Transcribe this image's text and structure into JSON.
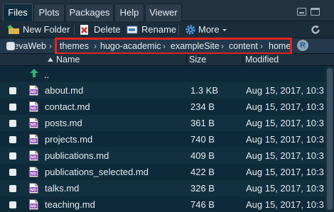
{
  "tabs": [
    {
      "label": "Files",
      "active": true
    },
    {
      "label": "Plots",
      "active": false
    },
    {
      "label": "Packages",
      "active": false
    },
    {
      "label": "Help",
      "active": false
    },
    {
      "label": "Viewer",
      "active": false
    }
  ],
  "toolbar": {
    "new_folder": "New Folder",
    "delete": "Delete",
    "rename": "Rename",
    "more": "More"
  },
  "breadcrumb": {
    "first": "evaWeb",
    "items": [
      "themes",
      "hugo-academic",
      "exampleSite",
      "content",
      "home"
    ]
  },
  "columns": {
    "name": "Name",
    "size": "Size",
    "modified": "Modified"
  },
  "parent_dir": "..",
  "files": [
    {
      "name": "about.md",
      "size": "1.3 KB",
      "modified": "Aug 15, 2017, 10:3"
    },
    {
      "name": "contact.md",
      "size": "234 B",
      "modified": "Aug 15, 2017, 10:3"
    },
    {
      "name": "posts.md",
      "size": "361 B",
      "modified": "Aug 15, 2017, 10:3"
    },
    {
      "name": "projects.md",
      "size": "740 B",
      "modified": "Aug 15, 2017, 10:3"
    },
    {
      "name": "publications.md",
      "size": "409 B",
      "modified": "Aug 15, 2017, 10:3"
    },
    {
      "name": "publications_selected.md",
      "size": "422 B",
      "modified": "Aug 15, 2017, 10:3"
    },
    {
      "name": "talks.md",
      "size": "326 B",
      "modified": "Aug 15, 2017, 10:3"
    },
    {
      "name": "teaching.md",
      "size": "746 B",
      "modified": "Aug 15, 2017, 10:3"
    }
  ],
  "colors": {
    "background": "#0e2a3a",
    "highlight": "#e5231b",
    "up_arrow": "#2fb36b",
    "md_icon": "#8e3fb0"
  }
}
